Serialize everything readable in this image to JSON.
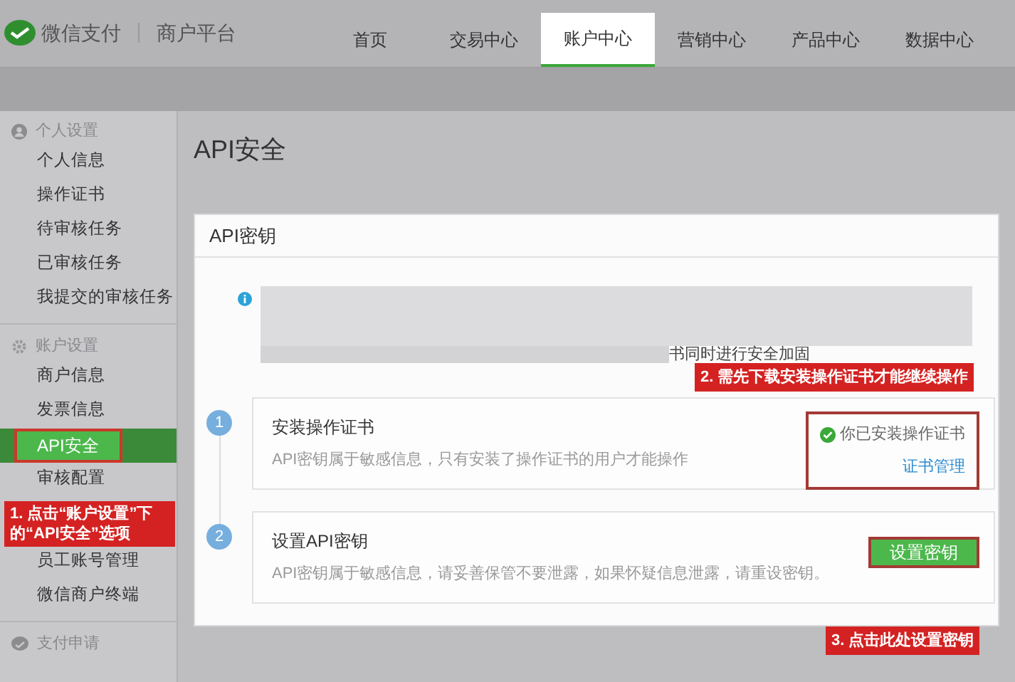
{
  "brand": {
    "name": "微信支付",
    "platform": "商户平台"
  },
  "nav": [
    {
      "label": "首页",
      "selected": false
    },
    {
      "label": "交易中心",
      "selected": false
    },
    {
      "label": "账户中心",
      "selected": true
    },
    {
      "label": "营销中心",
      "selected": false
    },
    {
      "label": "产品中心",
      "selected": false
    },
    {
      "label": "数据中心",
      "selected": false
    }
  ],
  "sidebar": [
    {
      "title": "个人设置",
      "kind": "person",
      "items": [
        {
          "label": "个人信息",
          "selected": false
        },
        {
          "label": "操作证书",
          "selected": false
        },
        {
          "label": "待审核任务",
          "selected": false
        },
        {
          "label": "已审核任务",
          "selected": false
        },
        {
          "label": "我提交的审核任务",
          "selected": false
        }
      ]
    },
    {
      "title": "账户设置",
      "kind": "gear",
      "items": [
        {
          "label": "商户信息",
          "selected": false
        },
        {
          "label": "发票信息",
          "selected": false
        },
        {
          "label": "API安全",
          "selected": true
        },
        {
          "label": "审核配置",
          "selected": false
        },
        {
          "label": "员工账号管理",
          "selected": false
        },
        {
          "label": "微信商户终端",
          "selected": false
        }
      ]
    },
    {
      "title": "支付申请",
      "kind": "chat"
    }
  ],
  "page_title": "API安全",
  "card": {
    "title": "API密钥",
    "notice_tail": "书同时进行安全加固",
    "steps": [
      {
        "number": "1",
        "title": "安装操作证书",
        "description": "API密钥属于敏感信息，只有安装了操作证书的用户才能操作",
        "kind": "status",
        "status": "你已安装操作证书",
        "link": "证书管理"
      },
      {
        "number": "2",
        "title": "设置API密钥",
        "description": "API密钥属于敏感信息，请妥善保管不要泄露，如果怀疑信息泄露，请重设密钥。",
        "kind": "button",
        "button": "设置密钥"
      }
    ]
  },
  "callouts": [
    "1. 点击“账户设置”下的“API安全”选项",
    "2. 需先下载安装操作证书才能继续操作",
    "3. 点击此处设置密钥"
  ]
}
